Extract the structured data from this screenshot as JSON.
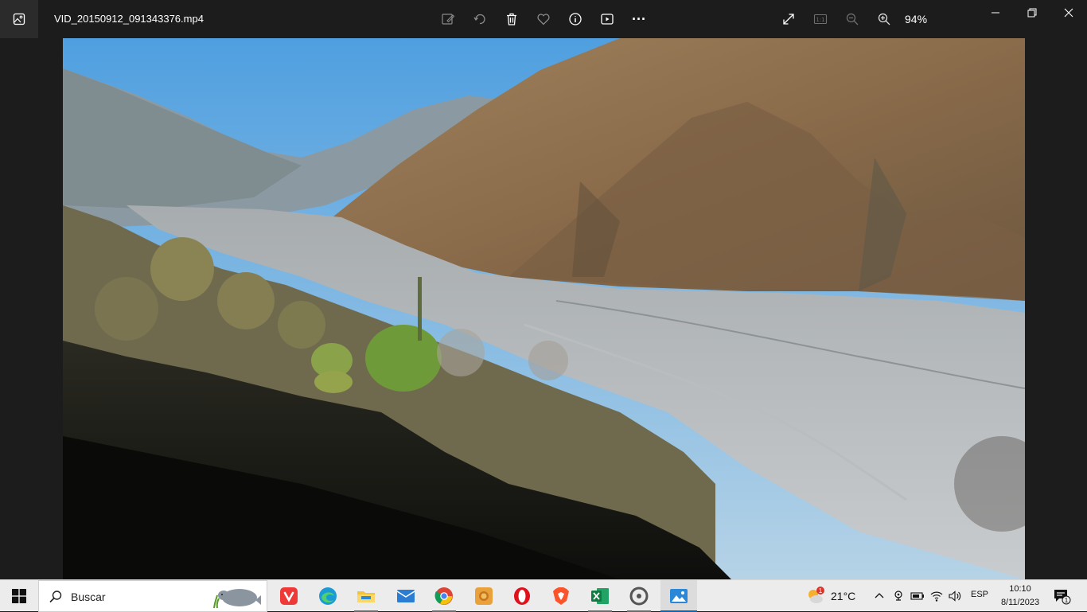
{
  "window": {
    "file_name": "VID_20150912_091343376.mp4",
    "zoom": "94%"
  },
  "toolbar": {
    "icons": [
      "edit-icon",
      "rotate-icon",
      "delete-icon",
      "favorite-icon",
      "info-icon",
      "slideshow-icon",
      "more-icon"
    ],
    "more_label": "···"
  },
  "view_controls": {
    "icons": [
      "fullscreen-icon",
      "actual-size-icon",
      "zoom-out-icon",
      "zoom-in-icon"
    ],
    "actual_size_label": "1:1"
  },
  "taskbar": {
    "search_placeholder": "Buscar",
    "apps": [
      "vivaldi",
      "edge",
      "file-explorer",
      "mail",
      "chrome",
      "app-sun",
      "opera",
      "brave",
      "excel",
      "app-circle",
      "photos"
    ],
    "weather_temp": "21°C",
    "weather_badge": "1",
    "language": "ESP",
    "time": "10:10",
    "date": "8/11/2023",
    "notification_count": "1"
  },
  "colors": {
    "accent": "#0067c0",
    "titlebar_bg": "#1c1c1c",
    "taskbar_bg": "#ececec"
  }
}
